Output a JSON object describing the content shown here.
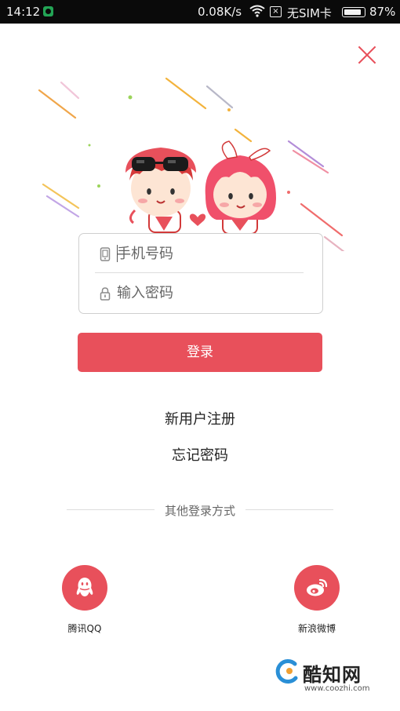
{
  "status_bar": {
    "time": "14:12",
    "network_speed": "0.08K/s",
    "sim_status": "无SIM卡",
    "battery_percent": "87%",
    "battery_level": 0.87
  },
  "login": {
    "phone_placeholder": "手机号码",
    "password_placeholder": "输入密码",
    "submit_label": "登录",
    "register_link": "新用户注册",
    "forgot_link": "忘记密码"
  },
  "other_login": {
    "title": "其他登录方式",
    "qq_label": "腾讯QQ",
    "weibo_label": "新浪微博"
  },
  "watermark": {
    "name": "酷知网",
    "url": "www.coozhi.com"
  },
  "colors": {
    "accent": "#e8505b",
    "status_bar_bg": "#0a0a0a",
    "text": "#222222"
  },
  "icons": [
    "app-notification-icon",
    "wifi-icon",
    "no-sim-icon",
    "battery-icon",
    "close-icon",
    "phone-icon",
    "lock-icon",
    "qq-icon",
    "weibo-icon",
    "watermark-logo"
  ]
}
